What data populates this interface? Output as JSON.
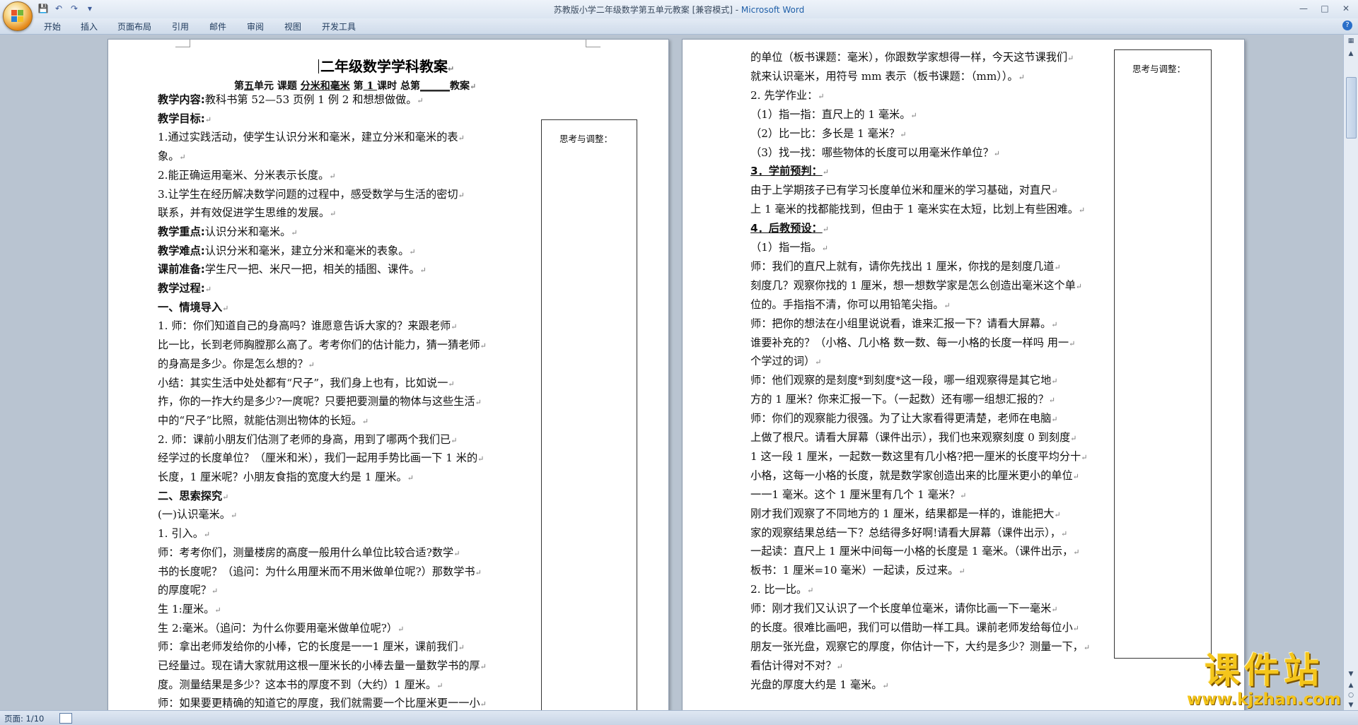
{
  "window": {
    "title_doc": "苏教版小学二年级数学第五单元教案 [兼容模式] - ",
    "title_app": "Microsoft Word"
  },
  "ribbon": {
    "tabs": [
      "开始",
      "插入",
      "页面布局",
      "引用",
      "邮件",
      "审阅",
      "视图",
      "开发工具"
    ]
  },
  "page1": {
    "title": "二年级数学学科教案",
    "meta": {
      "unit_prefix": "第",
      "unit_value": "五",
      "unit_suffix": "单元  课题 ",
      "topic": "分米和毫米",
      "lesson_prefix": "  第",
      "lesson_value": "  1  ",
      "lesson_suffix": "课时          总第",
      "total_value": "______",
      "total_suffix": "教案"
    },
    "side_label": "思考与调整：",
    "lines": [
      {
        "label": "教学内容:",
        "text": "教科书第 52—53 页例 1 例 2 和想想做做。"
      },
      {
        "label": "教学目标:",
        "text": ""
      },
      {
        "label": "",
        "text": "     1.通过实践活动，使学生认识分米和毫米，建立分米和毫米的表"
      },
      {
        "label": "",
        "text": "象。"
      },
      {
        "label": "",
        "text": "     2.能正确运用毫米、分米表示长度。"
      },
      {
        "label": "",
        "text": "     3.让学生在经历解决数学问题的过程中，感受数学与生活的密切"
      },
      {
        "label": "",
        "text": "联系，并有效促进学生思维的发展。"
      },
      {
        "label": "教学重点:",
        "text": "认识分米和毫米。"
      },
      {
        "label": "教学难点:",
        "text": "认识分米和毫米，建立分米和毫米的表象。"
      },
      {
        "label": "课前准备:",
        "text": "学生尺一把、米尺一把，相关的插图、课件。"
      },
      {
        "label": "教学过程:",
        "text": ""
      },
      {
        "label": "一、情境导入",
        "text": ""
      },
      {
        "label": "",
        "text": "     1. 师：你们知道自己的身高吗？谁愿意告诉大家的？来跟老师"
      },
      {
        "label": "",
        "text": "比一比，长到老师胸膛那么高了。考考你们的估计能力，猜一猜老师"
      },
      {
        "label": "",
        "text": "的身高是多少。你是怎么想的？"
      },
      {
        "label": "",
        "text": "     小结：其实生活中处处都有“尺子”，我们身上也有，比如说一"
      },
      {
        "label": "",
        "text": "拃，你的一拃大约是多少?一庹呢？只要把要测量的物体与这些生活"
      },
      {
        "label": "",
        "text": "中的“尺子”比照，就能估测出物体的长短。"
      },
      {
        "label": "",
        "text": "     2. 师：课前小朋友们估测了老师的身高，用到了哪两个我们已"
      },
      {
        "label": "",
        "text": "经学过的长度单位？（厘米和米），我们一起用手势比画一下 1 米的"
      },
      {
        "label": "",
        "text": "长度，1 厘米呢？小朋友食指的宽度大约是 1 厘米。"
      },
      {
        "label": "二、思索探究",
        "text": ""
      },
      {
        "label": "",
        "text": "     (一)认识毫米。"
      },
      {
        "label": "",
        "text": "     1. 引入。"
      },
      {
        "label": "",
        "text": "     师：考考你们，测量楼房的高度一般用什么单位比较合适?数学"
      },
      {
        "label": "",
        "text": "书的长度呢？（追问：为什么用厘米而不用米做单位呢?）那数学书"
      },
      {
        "label": "",
        "text": "的厚度呢？"
      },
      {
        "label": "",
        "text": "     生 1:厘米。"
      },
      {
        "label": "",
        "text": "     生 2:毫米。（追问：为什么你要用毫米做单位呢?）"
      },
      {
        "label": "",
        "text": "     师：拿出老师发给你的小棒，它的长度是一一1 厘米，课前我们"
      },
      {
        "label": "",
        "text": "已经量过。现在请大家就用这根一厘米长的小棒去量一量数学书的厚"
      },
      {
        "label": "",
        "text": "度。测量结果是多少？这本书的厚度不到（大约）1 厘米。"
      },
      {
        "label": "",
        "text": "师：如果要更精确的知道它的厚度，我们就需要一个比厘米更一一小"
      }
    ]
  },
  "page2": {
    "side_label": "思考与调整：",
    "lines": [
      {
        "label": "",
        "text": "的单位（板书课题：毫米），你跟数学家想得一样，今天这节课我们"
      },
      {
        "label": "",
        "text": "就来认识毫米，用符号 mm 表示（板书课题：（mm））。"
      },
      {
        "label": "",
        "text": "     2. 先学作业："
      },
      {
        "label": "",
        "text": "     （1）指一指：直尺上的 1 毫米。"
      },
      {
        "label": "",
        "text": "     （2）比一比：多长是 1 毫米？"
      },
      {
        "label": "",
        "text": "     （3）找一找：哪些物体的长度可以用毫米作单位？"
      },
      {
        "label": "     3．学前预判：",
        "text": ""
      },
      {
        "label": "",
        "text": "     由于上学期孩子已有学习长度单位米和厘米的学习基础，对直尺"
      },
      {
        "label": "",
        "text": "上 1 毫米的找都能找到，但由于 1 毫米实在太短，比划上有些困难。"
      },
      {
        "label": "     4．后教预设：",
        "text": ""
      },
      {
        "label": "",
        "text": "     （1）指一指。"
      },
      {
        "label": "",
        "text": "     师：我们的直尺上就有，请你先找出 1 厘米，你找的是刻度几道"
      },
      {
        "label": "",
        "text": "刻度几？观察你找的 1 厘米，想一想数学家是怎么创造出毫米这个单"
      },
      {
        "label": "",
        "text": "位的。手指指不清，你可以用铅笔尖指。"
      },
      {
        "label": "",
        "text": "     师：把你的想法在小组里说说看，谁来汇报一下？请看大屏幕。"
      },
      {
        "label": "",
        "text": "谁要补充的？（小格、几小格  数一数、每一小格的长度一样吗  用一"
      },
      {
        "label": "",
        "text": "个学过的词）"
      },
      {
        "label": "",
        "text": "     师：他们观察的是刻度*到刻度*这一段，哪一组观察得是其它地"
      },
      {
        "label": "",
        "text": "方的 1 厘米？你来汇报一下。（一起数）还有哪一组想汇报的？"
      },
      {
        "label": "",
        "text": "     师：你们的观察能力很强。为了让大家看得更清楚，老师在电脑"
      },
      {
        "label": "",
        "text": "上做了根尺。请看大屏幕（课件出示），我们也来观察刻度 0 到刻度"
      },
      {
        "label": "",
        "text": "1 这一段 1 厘米，一起数一数这里有几小格?把一厘米的长度平均分十"
      },
      {
        "label": "",
        "text": "小格，这每一小格的长度，就是数学家创造出来的比厘米更小的单位"
      },
      {
        "label": "",
        "text": "一一1 毫米。这个 1 厘米里有几个 1 毫米？"
      },
      {
        "label": "",
        "text": "     刚才我们观察了不同地方的 1 厘米，结果都是一样的，谁能把大"
      },
      {
        "label": "",
        "text": "家的观察结果总结一下？总结得多好啊!请看大屏幕（课件出示），"
      },
      {
        "label": "",
        "text": "一起读：直尺上 1 厘米中间每一小格的长度是 1 毫米。（课件出示，"
      },
      {
        "label": "",
        "text": "板书：1 厘米=10 毫米）一起读，反过来。"
      },
      {
        "label": "",
        "text": "     2. 比一比。"
      },
      {
        "label": "",
        "text": "     师：刚才我们又认识了一个长度单位毫米，请你比画一下一毫米"
      },
      {
        "label": "",
        "text": "的长度。很难比画吧，我们可以借助一样工具。课前老师发给每位小"
      },
      {
        "label": "",
        "text": "朋友一张光盘，观察它的厚度，你估计一下，大约是多少？测量一下，"
      },
      {
        "label": "",
        "text": "看估计得对不对？"
      },
      {
        "label": "",
        "text": "     光盘的厚度大约是 1 毫米。"
      }
    ]
  },
  "status": {
    "page_info": "页面: 1/10"
  },
  "watermark": {
    "big": "课件站",
    "small": "www.kjzhan.com"
  }
}
